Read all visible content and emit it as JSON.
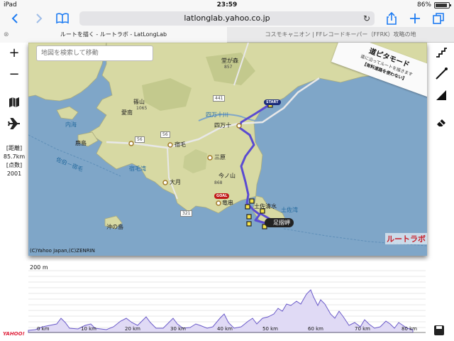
{
  "status": {
    "device": "iPad",
    "time": "23:59",
    "battery": "86%"
  },
  "browser": {
    "url": "latlonglab.yahoo.co.jp",
    "tabs": [
      {
        "label": "ルートを描く - ルートラボ - LatLongLab"
      },
      {
        "label": "コスモキャニオン | FFレコードキーパー（FFRK）攻略の地"
      }
    ]
  },
  "left_toolbar": {
    "zoom_in": "+",
    "zoom_out": "−",
    "distance_label": "[距離]",
    "distance_value": "85.7km",
    "points_label": "[点数]",
    "points_value": "2001"
  },
  "map": {
    "search_placeholder": "地図を検索して移動",
    "ribbon": {
      "title": "道ピタモード",
      "line1": "道に沿ってルートを描きます",
      "line2": "【有料道路を使わない】"
    },
    "copyright": "(C)Yahoo Japan,(C)ZENRIN",
    "logo": "ルートラボ",
    "places": {
      "dogamori": "堂が森",
      "dogamori_h": "857",
      "sasayama": "篠山",
      "sasayama_h": "1065",
      "shimanto_river": "四万十川",
      "shimanto": "四万十",
      "ainan": "愛南",
      "sukumo": "宿毛",
      "mihara": "三原",
      "imanoyama": "今ノ山",
      "imanoyama_h": "868",
      "otsuki": "大月",
      "tosashimizu": "土佐清水",
      "tatsukushi": "竜串",
      "okinoshima": "沖の島",
      "cape": "足摺岬",
      "kashima": "鹿島",
      "route_441": "441",
      "route_56a": "56",
      "route_56b": "56",
      "route_321": "321"
    },
    "seas": {
      "uchiumi": "内海",
      "sukumo_bay": "宿毛湾",
      "tosa_bay": "土佐湾",
      "ferry": "佐伯－宿毛"
    },
    "pins": {
      "start": "START",
      "goal": "GOAL"
    }
  },
  "elevation": {
    "ylabel": "200 m",
    "xlabels": [
      "0 km",
      "10 km",
      "20 km",
      "30 km",
      "40 km",
      "50 km",
      "60 km",
      "70 km",
      "80 km"
    ]
  },
  "footer": {
    "yahoo_logo": "YAHOO!"
  },
  "colors": {
    "route": "#5a4bd1",
    "accent": "#1e7cf2",
    "sea": "#7fa6c8",
    "land": "#d7d9a3"
  }
}
